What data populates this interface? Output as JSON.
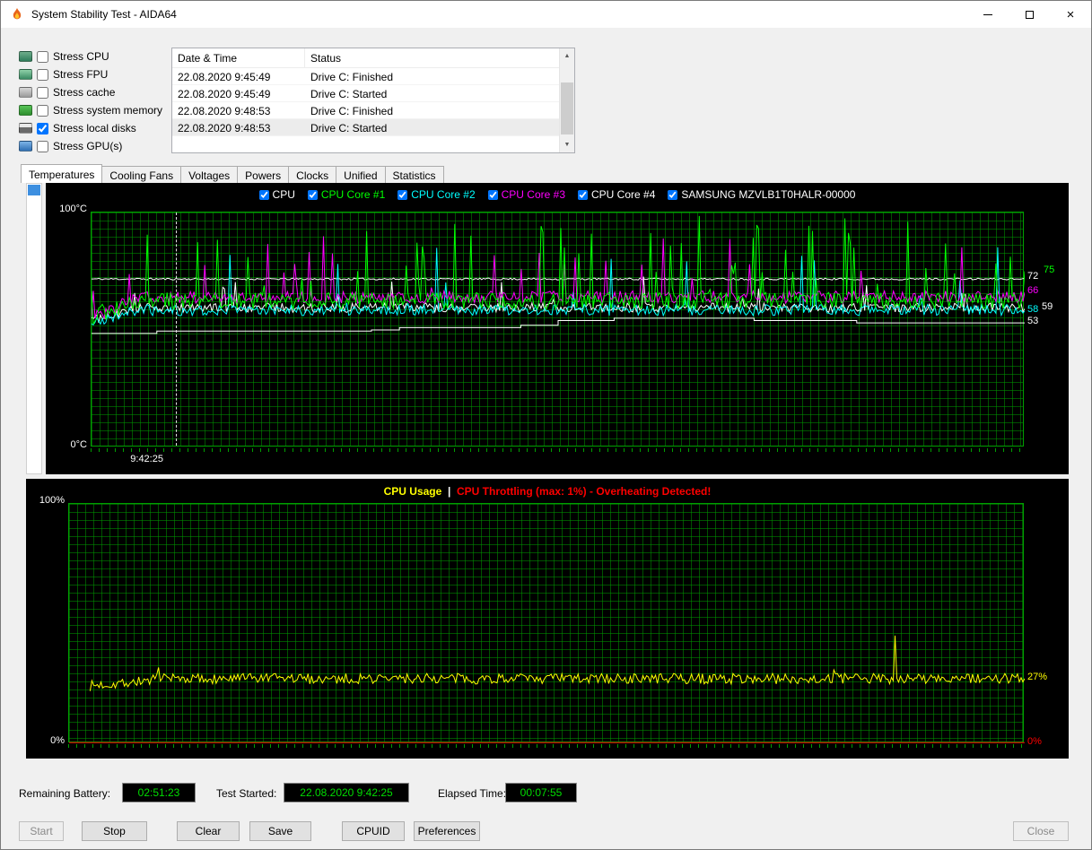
{
  "window": {
    "title": "System Stability Test - AIDA64",
    "controls": {
      "minimize": "minimize",
      "maximize": "maximize",
      "close": "×"
    }
  },
  "stress_options": {
    "items": [
      {
        "key": "cpu",
        "label": "Stress CPU",
        "checked": false,
        "icon": "cpu-icon"
      },
      {
        "key": "fpu",
        "label": "Stress FPU",
        "checked": false,
        "icon": "fpu-icon"
      },
      {
        "key": "cache",
        "label": "Stress cache",
        "checked": false,
        "icon": "cache-icon"
      },
      {
        "key": "memory",
        "label": "Stress system memory",
        "checked": false,
        "icon": "memory-icon"
      },
      {
        "key": "disks",
        "label": "Stress local disks",
        "checked": true,
        "icon": "disk-icon"
      },
      {
        "key": "gpu",
        "label": "Stress GPU(s)",
        "checked": false,
        "icon": "gpu-icon"
      }
    ]
  },
  "log_table": {
    "columns": [
      "Date & Time",
      "Status"
    ],
    "rows": [
      {
        "datetime": "22.08.2020 9:45:49",
        "status": "Drive C: Finished",
        "highlight": false
      },
      {
        "datetime": "22.08.2020 9:45:49",
        "status": "Drive C: Started",
        "highlight": false
      },
      {
        "datetime": "22.08.2020 9:48:53",
        "status": "Drive C: Finished",
        "highlight": false
      },
      {
        "datetime": "22.08.2020 9:48:53",
        "status": "Drive C: Started",
        "highlight": true
      }
    ]
  },
  "tabs": {
    "items": [
      {
        "label": "Temperatures",
        "active": true
      },
      {
        "label": "Cooling Fans",
        "active": false
      },
      {
        "label": "Voltages",
        "active": false
      },
      {
        "label": "Powers",
        "active": false
      },
      {
        "label": "Clocks",
        "active": false
      },
      {
        "label": "Unified",
        "active": false
      },
      {
        "label": "Statistics",
        "active": false
      }
    ]
  },
  "chart_data": [
    {
      "type": "line",
      "name": "temperatures",
      "ylim": [
        0,
        100
      ],
      "ylabel_top": "100°C",
      "ylabel_bottom": "0°C",
      "grid": true,
      "x_marker_label": "9:42:25",
      "x_marker_frac": 0.091,
      "legend": [
        {
          "label": "CPU",
          "color": "#ffffff",
          "checked": true
        },
        {
          "label": "CPU Core #1",
          "color": "#00ff00",
          "checked": true
        },
        {
          "label": "CPU Core #2",
          "color": "#00ffff",
          "checked": true
        },
        {
          "label": "CPU Core #3",
          "color": "#ff00ff",
          "checked": true
        },
        {
          "label": "CPU Core #4",
          "color": "#ffffff",
          "checked": true
        },
        {
          "label": "SAMSUNG MZVLB1T0HALR-00000",
          "color": "#ffffff",
          "checked": true
        }
      ],
      "series": [
        {
          "name": "CPU",
          "color": "#ffffff",
          "seed": 11,
          "gen": {
            "base": 71.7,
            "noise": 0.4,
            "spike_chance": 0,
            "spike_amp": 0
          },
          "end_value": 72
        },
        {
          "name": "SAMSUNG MZVLB1T0HALR-00000",
          "color": "#ffffff",
          "step_points": [
            [
              0,
              48.5
            ],
            [
              0.07,
              49.5
            ],
            [
              0.3,
              50
            ],
            [
              0.33,
              51
            ],
            [
              0.46,
              52
            ],
            [
              0.5,
              54
            ],
            [
              0.56,
              55
            ],
            [
              0.68,
              55
            ],
            [
              0.71,
              54
            ],
            [
              0.82,
              53
            ],
            [
              1,
              53
            ]
          ],
          "end_value": 53
        },
        {
          "name": "CPU Core #4",
          "color": "#ffffff",
          "seed": 41,
          "gen": {
            "base": 59.5,
            "noise": 2,
            "spike_chance": 0.03,
            "spike_amp": 16,
            "ramp_from": 54,
            "ramp_frac": 0.05
          },
          "end_value": 59
        },
        {
          "name": "CPU Core #2",
          "color": "#00ffff",
          "seed": 21,
          "gen": {
            "base": 58.5,
            "noise": 2.4,
            "spike_chance": 0.05,
            "spike_amp": 28,
            "ramp_from": 53,
            "ramp_frac": 0.05
          },
          "end_value": 58
        },
        {
          "name": "CPU Core #3",
          "color": "#ff00ff",
          "seed": 31,
          "gen": {
            "base": 64,
            "noise": 2.6,
            "spike_chance": 0.05,
            "spike_amp": 24,
            "ramp_from": 55,
            "ramp_frac": 0.05
          },
          "end_value": 66
        },
        {
          "name": "CPU Core #1",
          "color": "#00ff00",
          "seed": 51,
          "gen": {
            "base": 62.5,
            "noise": 3.5,
            "spike_chance": 0.1,
            "spike_amp": 34,
            "ramp_from": 55,
            "ramp_frac": 0.05
          },
          "end_value": 75
        }
      ],
      "right_labels": [
        {
          "text": "72",
          "value": 72,
          "color": "#ffffff",
          "dx": 0
        },
        {
          "text": "75",
          "value": 75,
          "color": "#00ff00",
          "dx": 18
        },
        {
          "text": "66",
          "value": 66,
          "color": "#ff00ff",
          "dx": 0
        },
        {
          "text": "58",
          "value": 58,
          "color": "#00ffff",
          "dx": 0
        },
        {
          "text": "59",
          "value": 59,
          "color": "#ffffff",
          "dx": 16
        },
        {
          "text": "53",
          "value": 53,
          "color": "#ffffff",
          "dx": 0
        }
      ]
    },
    {
      "type": "line",
      "name": "cpu-usage",
      "ylim": [
        0,
        100
      ],
      "ylabel_top": "100%",
      "ylabel_bottom": "0%",
      "grid": true,
      "title_parts": [
        {
          "text": "CPU Usage",
          "color": "#ffff00"
        },
        {
          "text": "  |  ",
          "color": "#ffffff"
        },
        {
          "text": "CPU Throttling (max: 1%) - Overheating Detected!",
          "color": "#ff0000"
        }
      ],
      "series": [
        {
          "name": "CPU Usage",
          "color": "#ffff00",
          "seed": 7,
          "gen": {
            "base": 27,
            "noise": 2.2,
            "spike_chance": 0.012,
            "spike_amp": 7,
            "ramp_from": 24,
            "ramp_frac": 0.08,
            "start_frac": 0.022,
            "events": [
              {
                "x": 0.865,
                "value": 45
              }
            ]
          },
          "end_value": 27
        },
        {
          "name": "CPU Throttling",
          "color": "#ff0000",
          "flat": 0.3
        }
      ],
      "right_labels": [
        {
          "text": "27%",
          "value": 27,
          "color": "#ffff00",
          "dx": 0
        },
        {
          "text": "0%",
          "value": 0,
          "color": "#ff0000",
          "dx": 0
        }
      ]
    }
  ],
  "footer": {
    "battery_label": "Remaining Battery:",
    "battery_value": "02:51:23",
    "started_label": "Test Started:",
    "started_value": "22.08.2020 9:42:25",
    "elapsed_label": "Elapsed Time:",
    "elapsed_value": "00:07:55"
  },
  "buttons": {
    "items": [
      {
        "key": "start",
        "label": "Start",
        "enabled": false
      },
      {
        "key": "stop",
        "label": "Stop",
        "enabled": true
      },
      {
        "key": "clear",
        "label": "Clear",
        "enabled": true
      },
      {
        "key": "save",
        "label": "Save",
        "enabled": true
      },
      {
        "key": "cpuid",
        "label": "CPUID",
        "enabled": true
      },
      {
        "key": "preferences",
        "label": "Preferences",
        "enabled": true
      },
      {
        "key": "close",
        "label": "Close",
        "enabled": false
      }
    ]
  }
}
